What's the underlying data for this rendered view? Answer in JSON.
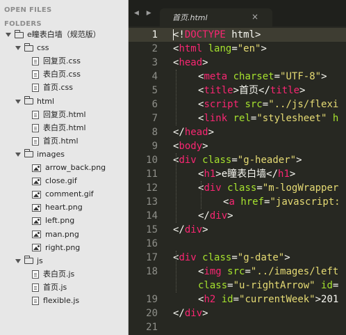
{
  "sidebar": {
    "open_files_label": "OPEN FILES",
    "folders_label": "FOLDERS",
    "tree": [
      {
        "kind": "folder",
        "depth": 0,
        "label": "e瞳表白墙（规范版）"
      },
      {
        "kind": "folder",
        "depth": 1,
        "label": "css"
      },
      {
        "kind": "file",
        "depth": 2,
        "label": "回复页.css"
      },
      {
        "kind": "file",
        "depth": 2,
        "label": "表白页.css"
      },
      {
        "kind": "file",
        "depth": 2,
        "label": "首页.css"
      },
      {
        "kind": "folder",
        "depth": 1,
        "label": "html"
      },
      {
        "kind": "file",
        "depth": 2,
        "label": "回复页.html"
      },
      {
        "kind": "file",
        "depth": 2,
        "label": "表白页.html"
      },
      {
        "kind": "file",
        "depth": 2,
        "label": "首页.html"
      },
      {
        "kind": "folder",
        "depth": 1,
        "label": "images"
      },
      {
        "kind": "image",
        "depth": 2,
        "label": "arrow_back.png"
      },
      {
        "kind": "image",
        "depth": 2,
        "label": "close.gif"
      },
      {
        "kind": "image",
        "depth": 2,
        "label": "comment.gif"
      },
      {
        "kind": "image",
        "depth": 2,
        "label": "heart.png"
      },
      {
        "kind": "image",
        "depth": 2,
        "label": "left.png"
      },
      {
        "kind": "image",
        "depth": 2,
        "label": "man.png"
      },
      {
        "kind": "image",
        "depth": 2,
        "label": "right.png"
      },
      {
        "kind": "folder",
        "depth": 1,
        "label": "js"
      },
      {
        "kind": "file",
        "depth": 2,
        "label": "表白页.js"
      },
      {
        "kind": "file",
        "depth": 2,
        "label": "首页.js"
      },
      {
        "kind": "file",
        "depth": 2,
        "label": "flexible.js"
      }
    ]
  },
  "tabbar": {
    "nav_arrows": "◀ ▶",
    "tab_title": "首页.html",
    "close_icon": "×"
  },
  "editor": {
    "active_line": 1,
    "colors": {
      "tag": "#f92672",
      "attr": "#a6e22e",
      "string": "#e6db74",
      "plain": "#f8f8f2",
      "background": "#272822"
    },
    "lines": [
      {
        "num": "1",
        "indent": 0,
        "tokens": [
          [
            "p",
            "<!"
          ],
          [
            "t",
            "DOCTYPE"
          ],
          [
            "p",
            " html>"
          ]
        ]
      },
      {
        "num": "2",
        "indent": 0,
        "tokens": [
          [
            "p",
            "<"
          ],
          [
            "t",
            "html"
          ],
          [
            "p",
            " "
          ],
          [
            "a",
            "lang"
          ],
          [
            "p",
            "="
          ],
          [
            "s",
            "\"en\""
          ],
          [
            "p",
            ">"
          ]
        ]
      },
      {
        "num": "3",
        "indent": 0,
        "tokens": [
          [
            "p",
            "<"
          ],
          [
            "t",
            "head"
          ],
          [
            "p",
            ">"
          ]
        ]
      },
      {
        "num": "4",
        "indent": 1,
        "tokens": [
          [
            "p",
            "<"
          ],
          [
            "t",
            "meta"
          ],
          [
            "p",
            " "
          ],
          [
            "a",
            "charset"
          ],
          [
            "p",
            "="
          ],
          [
            "s",
            "\"UTF-8\""
          ],
          [
            "p",
            ">"
          ]
        ]
      },
      {
        "num": "5",
        "indent": 1,
        "tokens": [
          [
            "p",
            "<"
          ],
          [
            "t",
            "title"
          ],
          [
            "p",
            ">首页</"
          ],
          [
            "t",
            "title"
          ],
          [
            "p",
            ">"
          ]
        ]
      },
      {
        "num": "6",
        "indent": 1,
        "tokens": [
          [
            "p",
            "<"
          ],
          [
            "t",
            "script"
          ],
          [
            "p",
            " "
          ],
          [
            "a",
            "src"
          ],
          [
            "p",
            "="
          ],
          [
            "s",
            "\"../js/flexi"
          ]
        ]
      },
      {
        "num": "7",
        "indent": 1,
        "tokens": [
          [
            "p",
            "<"
          ],
          [
            "t",
            "link"
          ],
          [
            "p",
            " "
          ],
          [
            "a",
            "rel"
          ],
          [
            "p",
            "="
          ],
          [
            "s",
            "\"stylesheet\""
          ],
          [
            "p",
            " "
          ],
          [
            "a",
            "h"
          ]
        ]
      },
      {
        "num": "8",
        "indent": 0,
        "tokens": [
          [
            "p",
            "</"
          ],
          [
            "t",
            "head"
          ],
          [
            "p",
            ">"
          ]
        ]
      },
      {
        "num": "9",
        "indent": 0,
        "tokens": [
          [
            "p",
            "<"
          ],
          [
            "t",
            "body"
          ],
          [
            "p",
            ">"
          ]
        ]
      },
      {
        "num": "10",
        "indent": 0,
        "tokens": [
          [
            "p",
            "<"
          ],
          [
            "t",
            "div"
          ],
          [
            "p",
            " "
          ],
          [
            "a",
            "class"
          ],
          [
            "p",
            "="
          ],
          [
            "s",
            "\"g-header\""
          ],
          [
            "p",
            ">"
          ]
        ]
      },
      {
        "num": "11",
        "indent": 1,
        "tokens": [
          [
            "p",
            "<"
          ],
          [
            "t",
            "h1"
          ],
          [
            "p",
            ">e瞳表白墙</"
          ],
          [
            "t",
            "h1"
          ],
          [
            "p",
            ">"
          ]
        ]
      },
      {
        "num": "12",
        "indent": 1,
        "tokens": [
          [
            "p",
            "<"
          ],
          [
            "t",
            "div"
          ],
          [
            "p",
            " "
          ],
          [
            "a",
            "class"
          ],
          [
            "p",
            "="
          ],
          [
            "s",
            "\"m-logWrapper"
          ]
        ]
      },
      {
        "num": "13",
        "indent": 2,
        "tokens": [
          [
            "p",
            "<"
          ],
          [
            "t",
            "a"
          ],
          [
            "p",
            " "
          ],
          [
            "a",
            "href"
          ],
          [
            "p",
            "="
          ],
          [
            "s",
            "\"javascript:"
          ]
        ]
      },
      {
        "num": "14",
        "indent": 1,
        "tokens": [
          [
            "p",
            "</"
          ],
          [
            "t",
            "div"
          ],
          [
            "p",
            ">"
          ]
        ]
      },
      {
        "num": "15",
        "indent": 0,
        "tokens": [
          [
            "p",
            "</"
          ],
          [
            "t",
            "div"
          ],
          [
            "p",
            ">"
          ]
        ]
      },
      {
        "num": "16",
        "indent": 0,
        "tokens": []
      },
      {
        "num": "17",
        "indent": 0,
        "tokens": [
          [
            "p",
            "<"
          ],
          [
            "t",
            "div"
          ],
          [
            "p",
            " "
          ],
          [
            "a",
            "class"
          ],
          [
            "p",
            "="
          ],
          [
            "s",
            "\"g-date\""
          ],
          [
            "p",
            ">"
          ]
        ]
      },
      {
        "num": "18",
        "indent": 1,
        "tokens": [
          [
            "p",
            "<"
          ],
          [
            "t",
            "img"
          ],
          [
            "p",
            " "
          ],
          [
            "a",
            "src"
          ],
          [
            "p",
            "="
          ],
          [
            "s",
            "\"../images/left"
          ]
        ]
      },
      {
        "num": "",
        "indent": 1,
        "tokens": [
          [
            "a",
            "class"
          ],
          [
            "p",
            "="
          ],
          [
            "s",
            "\"u-rightArrow\""
          ],
          [
            "p",
            " "
          ],
          [
            "a",
            "id"
          ],
          [
            "p",
            "="
          ]
        ]
      },
      {
        "num": "19",
        "indent": 1,
        "tokens": [
          [
            "p",
            "<"
          ],
          [
            "t",
            "h2"
          ],
          [
            "p",
            " "
          ],
          [
            "a",
            "id"
          ],
          [
            "p",
            "="
          ],
          [
            "s",
            "\"currentWeek\""
          ],
          [
            "p",
            ">201"
          ]
        ]
      },
      {
        "num": "20",
        "indent": 0,
        "tokens": [
          [
            "p",
            "</"
          ],
          [
            "t",
            "div"
          ],
          [
            "p",
            ">"
          ]
        ]
      },
      {
        "num": "21",
        "indent": 0,
        "tokens": []
      }
    ]
  }
}
